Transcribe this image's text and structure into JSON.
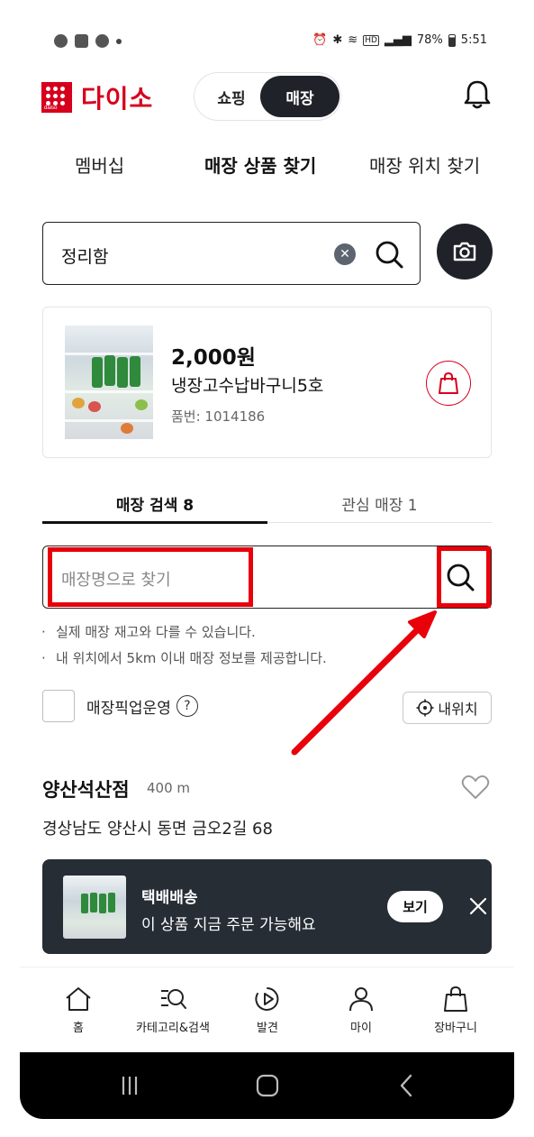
{
  "status_bar": {
    "battery": "78%",
    "time": "5:51",
    "icons": [
      "talk-icon",
      "gallery-icon",
      "app-icon",
      "dot-icon",
      "alarm-icon",
      "bluetooth-icon",
      "wifi-icon",
      "hd-icon",
      "signal-icon",
      "battery-icon"
    ]
  },
  "header": {
    "brand": "다이소",
    "brand_small": "daiso",
    "toggle_shopping": "쇼핑",
    "toggle_store": "매장",
    "toggle_selected": "매장"
  },
  "top_tabs": [
    {
      "label": "멤버십",
      "active": false
    },
    {
      "label": "매장 상품 찾기",
      "active": true
    },
    {
      "label": "매장 위치 찾기",
      "active": false
    }
  ],
  "search": {
    "value": "정리함"
  },
  "product": {
    "price": "2,000원",
    "name": "냉장고수납바구니5호",
    "code": "품번: 1014186"
  },
  "store_tabs": [
    {
      "label": "매장 검색 8",
      "active": true
    },
    {
      "label": "관심 매장 1",
      "active": false
    }
  ],
  "store_search": {
    "placeholder": "매장명으로 찾기"
  },
  "notes": [
    "실제 매장 재고와 다를 수 있습니다.",
    "내 위치에서 5km 이내 매장 정보를 제공합니다."
  ],
  "pickup": {
    "label": "매장픽업운영",
    "help": "?",
    "checked": false
  },
  "my_location": {
    "label": "내위치"
  },
  "store_result": {
    "name": "양산석산점",
    "distance": "400 m",
    "address": "경상남도 양산시 동면 금오2길 68"
  },
  "toast": {
    "title": "택배배송",
    "subtitle": "이 상품 지금 주문 가능해요",
    "view_button": "보기"
  },
  "bottom_nav": [
    {
      "label": "홈",
      "icon": "home-icon"
    },
    {
      "label": "카테고리&검색",
      "icon": "category-search-icon"
    },
    {
      "label": "발견",
      "icon": "play-icon"
    },
    {
      "label": "마이",
      "icon": "person-icon"
    },
    {
      "label": "장바구니",
      "icon": "bag-icon"
    }
  ],
  "colors": {
    "brand_red": "#d6001c",
    "dark": "#1f2329",
    "annotation_red": "#e8000b",
    "toast_bg": "#272d35"
  }
}
